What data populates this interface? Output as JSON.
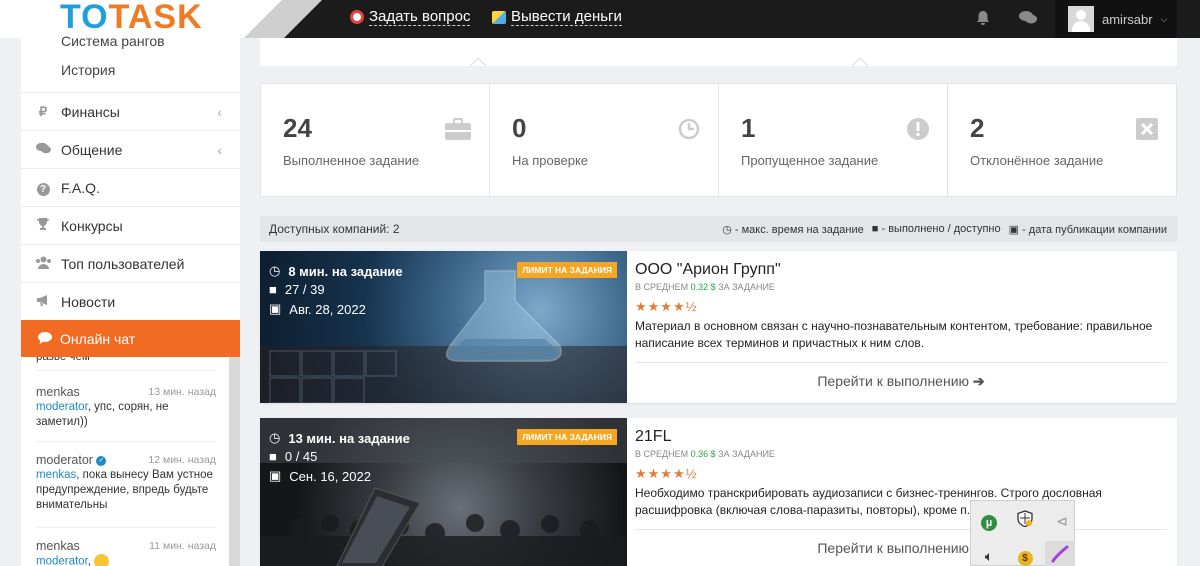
{
  "header": {
    "logo_to": "TO",
    "logo_task": "TASK",
    "ask_question": "Задать вопрос",
    "withdraw": "Вывести деньги",
    "username": "amirsabr"
  },
  "sidebar": {
    "sub_items": [
      "Система рангов",
      "История"
    ],
    "items": [
      {
        "label": "Финансы",
        "icon": "ruble-icon"
      },
      {
        "label": "Общение",
        "icon": "comments-icon"
      },
      {
        "label": "F.A.Q.",
        "icon": "question-icon"
      },
      {
        "label": "Конкурсы",
        "icon": "trophy-icon"
      },
      {
        "label": "Топ пользователей",
        "icon": "users-icon"
      },
      {
        "label": "Новости",
        "icon": "bullhorn-icon"
      }
    ],
    "chat_title": "Онлайн чат"
  },
  "chat": {
    "cut_text": "разве чем",
    "messages": [
      {
        "author": "menkas",
        "time": "13 мин. назад",
        "to": "moderator",
        "text": ", упс, сорян, не заметил))"
      },
      {
        "author": "moderator",
        "time": "12 мин. назад",
        "to": "menkas",
        "text": ", пока вынесу Вам устное предупреждение, впредь будьте внимательны"
      },
      {
        "author": "menkas",
        "time": "11 мин. назад",
        "to": "moderator",
        "text": ","
      }
    ]
  },
  "stats": [
    {
      "value": "24",
      "label": "Выполненное задание",
      "icon": "briefcase-icon"
    },
    {
      "value": "0",
      "label": "На проверке",
      "icon": "clock-icon"
    },
    {
      "value": "1",
      "label": "Пропущенное задание",
      "icon": "exclamation-icon"
    },
    {
      "value": "2",
      "label": "Отклонённое задание",
      "icon": "times-icon"
    }
  ],
  "info_bar": {
    "available": "Доступных компаний: 2",
    "legend_time": "- макс. время на задание",
    "legend_done": "- выполнено / доступно",
    "legend_date": "- дата публикации компании"
  },
  "cards": [
    {
      "time": "8 мин. на задание",
      "progress": "27 / 39",
      "date": "Авг. 28, 2022",
      "badge": "ЛИМИТ НА ЗАДАНИЯ",
      "title": "ООО \"Арион Групп\"",
      "avg_prefix": "В СРЕДНЕМ",
      "avg_value": "0.32 $",
      "avg_suffix": "ЗА ЗАДАНИЕ",
      "rating": 4.5,
      "stars": "★★★★½",
      "description": "Материал в основном связан с научно-познавательным контентом, требование: правильное написание всех терминов и причастных к ним слов.",
      "link": "Перейти к выполнению"
    },
    {
      "time": "13 мин. на задание",
      "progress": "0 / 45",
      "date": "Сен. 16, 2022",
      "badge": "ЛИМИТ НА ЗАДАНИЯ",
      "title": "21FL",
      "avg_prefix": "В СРЕДНЕМ",
      "avg_value": "0.36 $",
      "avg_suffix": "ЗА ЗАДАНИЕ",
      "rating": 4.5,
      "stars": "★★★★½",
      "description": "Необходимо транскрибировать аудиозаписи с бизнес-тренингов. Строго дословная расшифровка (включая слова-паразиты, повторы), кроме п... ...оперебивов.",
      "link": "Перейти к выполнению"
    }
  ],
  "colors": {
    "accent": "#f26b22",
    "logo_blue": "#1ea0dc",
    "logo_orange": "#f07b25",
    "topbar": "#1b1b1b",
    "badge": "#f5a623",
    "star": "#e07b39"
  }
}
